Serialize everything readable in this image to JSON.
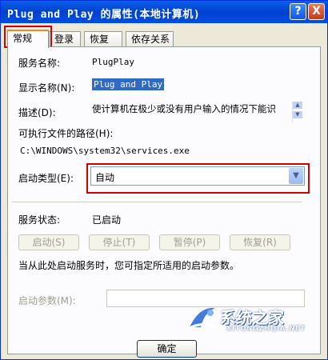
{
  "window": {
    "title": "Plug and Play 的属性(本地计算机)",
    "help_button": "?",
    "close_button": "X"
  },
  "tabs": [
    {
      "label": "常规",
      "active": true
    },
    {
      "label": "登录",
      "active": false
    },
    {
      "label": "恢复",
      "active": false
    },
    {
      "label": "依存关系",
      "active": false
    }
  ],
  "general": {
    "service_name_label": "服务名称:",
    "service_name_value": "PlugPlay",
    "display_name_label": "显示名称(N):",
    "display_name_value": "Plug and Play",
    "description_label": "描述(D):",
    "description_value": "使计算机在极少或没有用户输入的情况下能识",
    "exe_path_label": "可执行文件的路径(H):",
    "exe_path_value": "C:\\WINDOWS\\system32\\services.exe",
    "startup_type_label": "启动类型(E):",
    "startup_type_value": "自动",
    "service_status_label": "服务状态:",
    "service_status_value": "已启动",
    "buttons": {
      "start": "启动(S)",
      "stop": "停止(T)",
      "pause": "暂停(P)",
      "resume": "恢复(R)"
    },
    "hint_text": "当从此处启动服务时，您可指定所适用的启动参数。",
    "start_params_label": "启动参数(M):",
    "start_params_value": ""
  },
  "footer": {
    "ok_button": "确定"
  },
  "watermark": {
    "text": "系统之家",
    "sub": "XITONGZHIJIA.NET"
  },
  "colors": {
    "titlebar": "#0A5FE8",
    "highlight_box": "#D40000",
    "tab_active_accent": "#E68B2C"
  }
}
